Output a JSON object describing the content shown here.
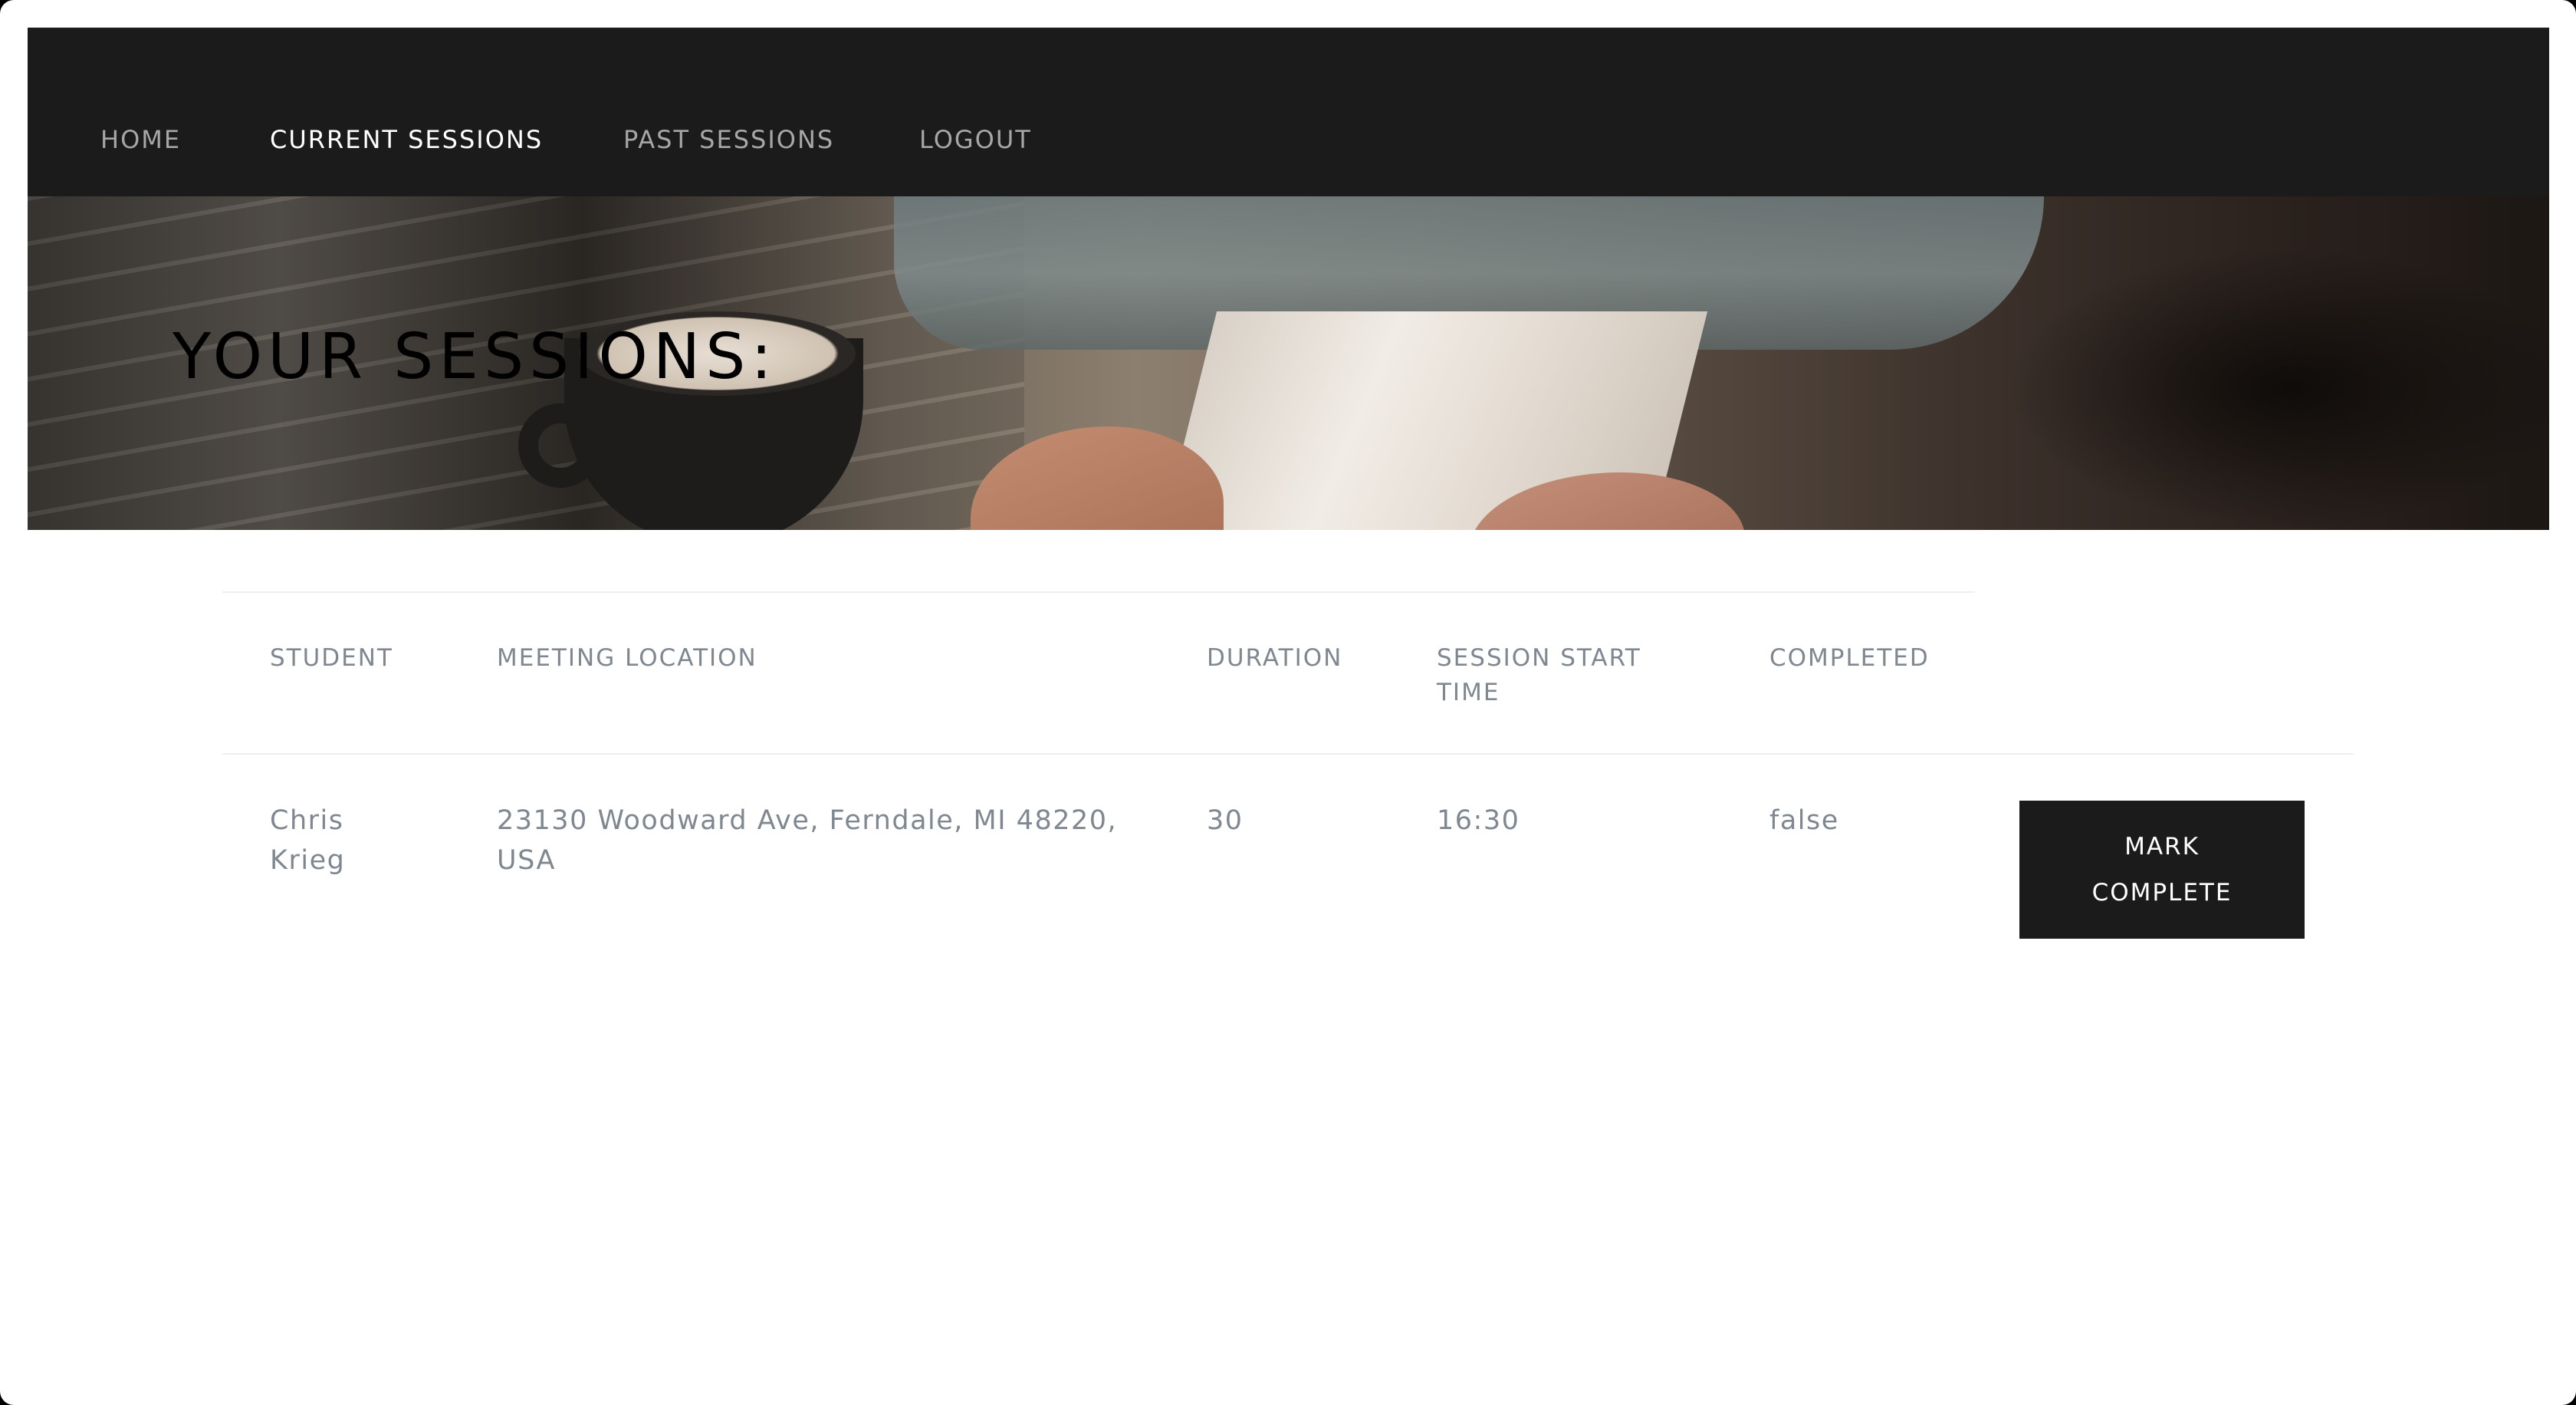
{
  "nav": {
    "items": [
      {
        "label": "HOME",
        "active": false
      },
      {
        "label": "CURRENT SESSIONS",
        "active": true
      },
      {
        "label": "PAST SESSIONS",
        "active": false
      },
      {
        "label": "LOGOUT",
        "active": false
      }
    ]
  },
  "hero": {
    "title": "YOUR SESSIONS:"
  },
  "table": {
    "headers": {
      "student": "STUDENT",
      "location": "MEETING LOCATION",
      "duration": "DURATION",
      "start_time": "SESSION START TIME",
      "completed": "COMPLETED"
    },
    "rows": [
      {
        "student": "Chris Krieg",
        "location": "23130 Woodward Ave, Ferndale, MI 48220, USA",
        "duration": "30",
        "start_time": "16:30",
        "completed": "false",
        "action_label": "MARK COMPLETE"
      }
    ]
  },
  "colors": {
    "nav_background": "#1b1b1b",
    "nav_active_text": "#ffffff",
    "nav_inactive_text": "#a7a7a7",
    "table_text": "#7f8890",
    "button_background": "#1b1b1b",
    "button_text": "#ffffff"
  }
}
